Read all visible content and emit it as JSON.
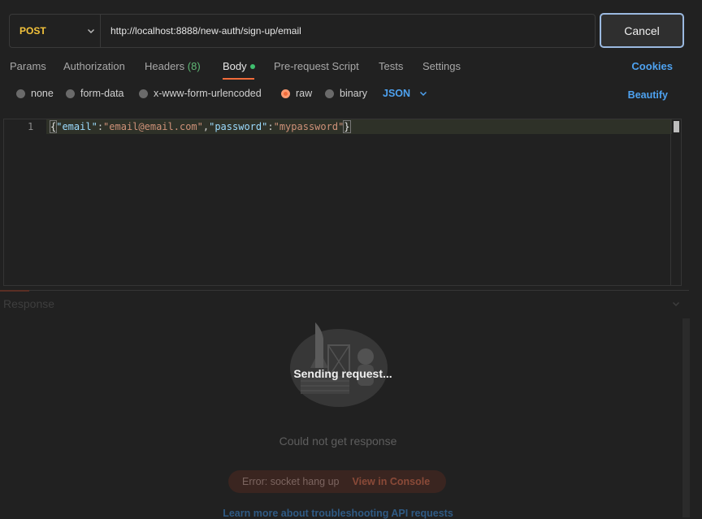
{
  "request": {
    "method": "POST",
    "url": "http://localhost:8888/new-auth/sign-up/email",
    "cancel_label": "Cancel"
  },
  "tabs": {
    "params": "Params",
    "authorization": "Authorization",
    "headers": "Headers",
    "headers_count": "(8)",
    "body": "Body",
    "prerequest": "Pre-request Script",
    "tests": "Tests",
    "settings": "Settings",
    "active": "Body"
  },
  "cookies_label": "Cookies",
  "body_types": {
    "none": "none",
    "form_data": "form-data",
    "urlencoded": "x-www-form-urlencoded",
    "raw": "raw",
    "binary": "binary",
    "selected": "raw"
  },
  "format": "JSON",
  "beautify_label": "Beautify",
  "editor": {
    "line_number": "1",
    "tokens": {
      "open_brace": "{",
      "key1": "\"email\"",
      "colon1": ":",
      "val1": "\"email@email.com\"",
      "comma": ",",
      "key2": "\"password\"",
      "colon2": ":",
      "val2": "\"mypassword\"",
      "close_brace": "}"
    }
  },
  "response": {
    "label": "Response",
    "status": "Sending request...",
    "message": "Could not get response",
    "error_text": "Error: socket hang up",
    "console_link": "View in Console",
    "help_link": "Learn more about troubleshooting API requests"
  },
  "colors": {
    "method": "#f4c33b",
    "accent": "#4ea2f0",
    "active_tab": "#f26b3a",
    "body_dot": "#3fbf6f"
  }
}
